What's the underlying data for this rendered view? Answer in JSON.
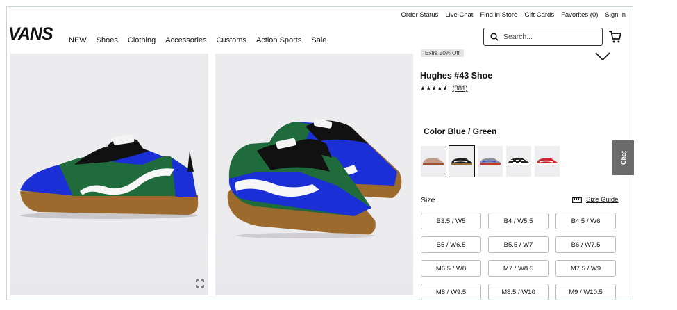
{
  "utility_nav": [
    "Order Status",
    "Live Chat",
    "Find in Store",
    "Gift Cards",
    "Favorites (0)",
    "Sign In"
  ],
  "brand": {
    "logo_text": "VANS"
  },
  "main_nav": [
    "NEW",
    "Shoes",
    "Clothing",
    "Accessories",
    "Customs",
    "Action Sports",
    "Sale"
  ],
  "search": {
    "placeholder": "Search..."
  },
  "product": {
    "badge": "Extra 30% Off",
    "name": "Hughes #43 Shoe",
    "stars": "★★★★★",
    "rating": 4.5,
    "review_count": "(881)",
    "color_label": "Color Blue / Green",
    "swatches": [
      "tan-pink",
      "black-gum",
      "gray-blue",
      "checker",
      "red"
    ],
    "selected_swatch": 1,
    "size_label": "Size",
    "size_guide": "Size Guide",
    "sizes": [
      "B3.5 / W5",
      "B4 / W5.5",
      "B4.5 / W6",
      "B5 / W6.5",
      "B5.5 / W7",
      "B6 / W7.5",
      "M6.5 / W8",
      "M7 / W8.5",
      "M7.5 / W9",
      "M8 / W9.5",
      "M8.5 / W10",
      "M9 / W10.5"
    ]
  },
  "chat_tab": "Chat",
  "colors": {
    "blue": "#1b2fd6",
    "green": "#1f6b3c",
    "gum": "#9c6a2c",
    "accent": "#111111"
  }
}
